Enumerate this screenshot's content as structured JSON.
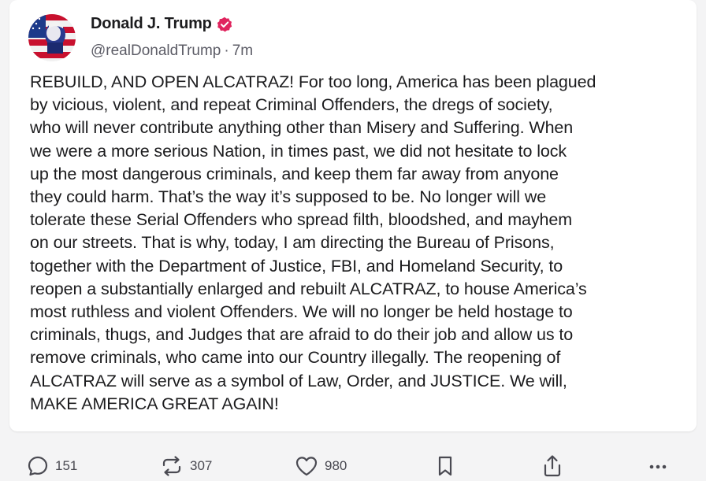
{
  "post": {
    "author_name": "Donald J. Trump",
    "handle": "@realDonaldTrump",
    "separator": "·",
    "time_ago": "7m",
    "verified": true,
    "body": "REBUILD, AND OPEN ALCATRAZ! For too long, America has been plagued\nby vicious, violent, and repeat Criminal Offenders, the dregs of society,\nwho will never contribute anything other than Misery and Suffering. When\nwe were a more serious Nation, in times past, we did not hesitate to lock\nup the most dangerous criminals, and keep them far away from anyone\nthey could harm. That’s the way it’s supposed to be. No longer will we\ntolerate these Serial Offenders who spread filth, bloodshed, and mayhem\non our streets. That is why, today, I am directing the Bureau of Prisons,\ntogether with the Department of Justice, FBI, and Homeland Security, to\nreopen a substantially enlarged and rebuilt ALCATRAZ, to house America’s\nmost ruthless and violent Offenders. We will no longer be held hostage to\ncriminals, thugs, and Judges that are afraid to do their job and allow us to\nremove criminals, who came into our Country illegally. The reopening of\nALCATRAZ will serve as a symbol of Law, Order, and JUSTICE. We will,\nMAKE AMERICA GREAT AGAIN!"
  },
  "actions": {
    "reply": {
      "icon": "reply-icon",
      "count": "151"
    },
    "retruth": {
      "icon": "retruth-icon",
      "count": "307"
    },
    "like": {
      "icon": "heart-icon",
      "count": "980"
    },
    "bookmark": {
      "icon": "bookmark-icon"
    },
    "share": {
      "icon": "share-icon"
    },
    "more": {
      "icon": "more-icon"
    }
  },
  "colors": {
    "background": "#f4f4f5",
    "card": "#ffffff",
    "text": "#1c1c1e",
    "muted": "#5c5c66",
    "verified_badge": "#e0245e"
  }
}
